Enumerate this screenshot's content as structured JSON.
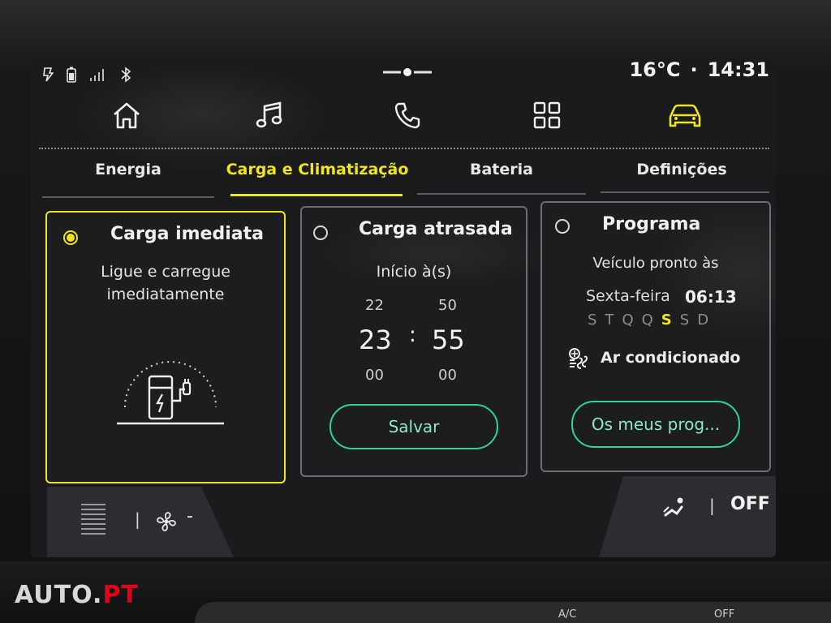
{
  "status_bar": {
    "temperature": "16°C",
    "separator": "·",
    "time": "14:31",
    "icons": [
      "battery-status-icon",
      "phone-battery-icon",
      "signal-icon",
      "bluetooth-icon"
    ]
  },
  "nav": {
    "items": [
      {
        "name": "home",
        "icon": "home-icon"
      },
      {
        "name": "music",
        "icon": "music-icon"
      },
      {
        "name": "phone",
        "icon": "phone-icon"
      },
      {
        "name": "apps",
        "icon": "apps-grid-icon"
      },
      {
        "name": "vehicle",
        "icon": "car-icon",
        "active": true
      }
    ]
  },
  "tabs": [
    {
      "label": "Energia"
    },
    {
      "label": "Carga e Climatização",
      "active": true
    },
    {
      "label": "Bateria"
    },
    {
      "label": "Definições"
    }
  ],
  "cards": {
    "immediate": {
      "title": "Carga imediata",
      "subtitle_line1": "Ligue e carregue",
      "subtitle_line2": "imediatamente",
      "selected": true
    },
    "delayed": {
      "title": "Carga atrasada",
      "start_label": "Início à(s)",
      "hour_prev": "22",
      "hour": "23",
      "hour_next": "00",
      "colon": ":",
      "minute_prev": "50",
      "minute": "55",
      "minute_next": "00",
      "save_label": "Salvar",
      "selected": false
    },
    "program": {
      "title": "Programa",
      "ready_label": "Veículo pronto às",
      "day_label": "Sexta-feira",
      "ready_time": "06:13",
      "days": [
        "S",
        "T",
        "Q",
        "Q",
        "S",
        "S",
        "D"
      ],
      "current_day_index": 4,
      "ac_label": "Ar condicionado",
      "my_programs_label": "Os meus prog...",
      "selected": false
    }
  },
  "climate": {
    "left_separator": "|",
    "fan_level": "-",
    "right_separator": "|",
    "right_status": "OFF"
  },
  "console": {
    "ac_label": "A/C",
    "off_label": "OFF"
  },
  "watermark": {
    "main": "AUTO",
    "dot": ".",
    "suffix": "PT"
  },
  "colors": {
    "accent_yellow": "#f2e416",
    "accent_green": "#2fd39a",
    "screen_bg": "#1a1b1d",
    "card_border": "#6b6d70"
  }
}
